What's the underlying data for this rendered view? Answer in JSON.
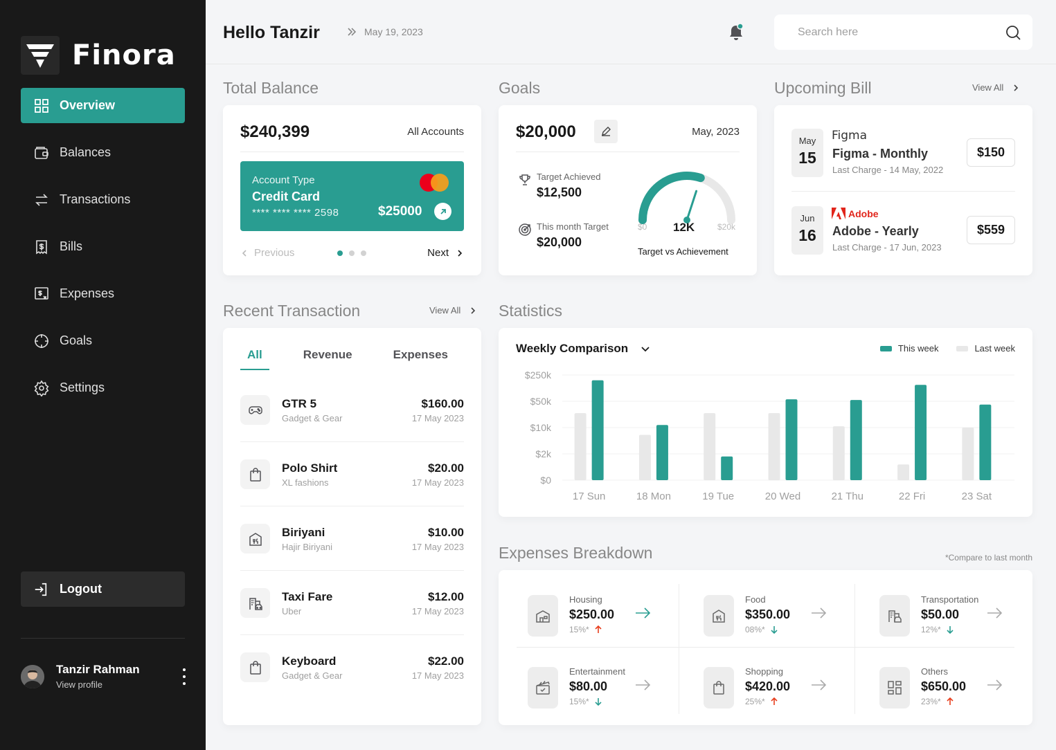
{
  "brand": {
    "name": "Finora"
  },
  "sidebar": {
    "items": [
      {
        "label": "Overview",
        "icon": "grid-icon",
        "active": true
      },
      {
        "label": "Balances",
        "icon": "wallet-icon",
        "active": false
      },
      {
        "label": "Transactions",
        "icon": "arrows-swap-icon",
        "active": false
      },
      {
        "label": "Bills",
        "icon": "bill-icon",
        "active": false
      },
      {
        "label": "Expenses",
        "icon": "expense-icon",
        "active": false
      },
      {
        "label": "Goals",
        "icon": "target-icon",
        "active": false
      },
      {
        "label": "Settings",
        "icon": "gear-icon",
        "active": false
      }
    ],
    "logout_label": "Logout",
    "profile": {
      "name": "Tanzir Rahman",
      "link": "View profile"
    }
  },
  "header": {
    "greeting": "Hello Tanzir",
    "date": "May 19, 2023",
    "search_placeholder": "Search here"
  },
  "total_balance": {
    "title": "Total Balance",
    "amount": "$240,399",
    "accounts_label": "All Accounts",
    "card": {
      "type_label": "Account Type",
      "type": "Credit Card",
      "number": "**** **** **** 2598",
      "balance": "$25000"
    },
    "prev_label": "Previous",
    "next_label": "Next"
  },
  "goals": {
    "title": "Goals",
    "amount": "$20,000",
    "date": "May, 2023",
    "achieved_label": "Target Achieved",
    "achieved_value": "$12,500",
    "month_label": "This month Target",
    "month_value": "$20,000",
    "gauge": {
      "min": "$0",
      "max": "$20k",
      "value_label": "12K",
      "value": 12000,
      "max_value": 20000
    },
    "caption": "Target vs Achievement"
  },
  "bills": {
    "title": "Upcoming Bill",
    "view_all": "View All",
    "items": [
      {
        "month": "May",
        "day": "15",
        "brand": "Figma",
        "name": "Figma - Monthly",
        "last": "Last Charge - 14 May, 2022",
        "amount": "$150"
      },
      {
        "month": "Jun",
        "day": "16",
        "brand": "Adobe",
        "name": "Adobe - Yearly",
        "last": "Last Charge - 17 Jun, 2023",
        "amount": "$559"
      }
    ]
  },
  "transactions": {
    "title": "Recent Transaction",
    "view_all": "View All",
    "tabs": [
      "All",
      "Revenue",
      "Expenses"
    ],
    "items": [
      {
        "name": "GTR 5",
        "category": "Gadget & Gear",
        "amount": "$160.00",
        "date": "17 May 2023",
        "icon": "gamepad-icon"
      },
      {
        "name": "Polo Shirt",
        "category": "XL fashions",
        "amount": "$20.00",
        "date": "17 May 2023",
        "icon": "shopping-bag-icon"
      },
      {
        "name": "Biriyani",
        "category": "Hajir Biriyani",
        "amount": "$10.00",
        "date": "17 May 2023",
        "icon": "restaurant-icon"
      },
      {
        "name": "Taxi Fare",
        "category": "Uber",
        "amount": "$12.00",
        "date": "17 May 2023",
        "icon": "taxi-building-icon"
      },
      {
        "name": "Keyboard",
        "category": "Gadget & Gear",
        "amount": "$22.00",
        "date": "17 May 2023",
        "icon": "shopping-bag-icon"
      }
    ]
  },
  "statistics": {
    "title": "Statistics",
    "subtitle": "Weekly Comparison",
    "legend": {
      "this_week": "This week",
      "last_week": "Last week"
    },
    "colors": {
      "this_week": "#299d91",
      "last_week": "#e8e8e8"
    }
  },
  "chart_data": {
    "type": "bar",
    "title": "Weekly Comparison",
    "categories": [
      "17 Sun",
      "18 Mon",
      "19 Tue",
      "20 Wed",
      "21 Thu",
      "22 Fri",
      "23 Sat"
    ],
    "y_ticks": [
      "$250k",
      "$50k",
      "$10k",
      "$2k",
      "$0"
    ],
    "y_tick_values": [
      250000,
      50000,
      10000,
      2000,
      0
    ],
    "series": [
      {
        "name": "Last week",
        "values": [
          32000,
          7800,
          32000,
          32000,
          12000,
          1200,
          10000
        ]
      },
      {
        "name": "This week",
        "values": [
          210000,
          14000,
          1800,
          65000,
          60000,
          175000,
          45000
        ]
      }
    ],
    "legend_position": "top-right",
    "grid": true
  },
  "expenses": {
    "title": "Expenses Breakdown",
    "note": "*Compare to last month",
    "items": [
      {
        "label": "Housing",
        "value": "$250.00",
        "pct": "15%*",
        "trend": "up",
        "icon": "house-icon"
      },
      {
        "label": "Food",
        "value": "$350.00",
        "pct": "08%*",
        "trend": "down",
        "icon": "restaurant-icon"
      },
      {
        "label": "Transportation",
        "value": "$50.00",
        "pct": "12%*",
        "trend": "down",
        "icon": "taxi-building-icon"
      },
      {
        "label": "Entertainment",
        "value": "$80.00",
        "pct": "15%*",
        "trend": "down",
        "icon": "clapper-icon"
      },
      {
        "label": "Shopping",
        "value": "$420.00",
        "pct": "25%*",
        "trend": "up",
        "icon": "shopping-bag-icon"
      },
      {
        "label": "Others",
        "value": "$650.00",
        "pct": "23%*",
        "trend": "up",
        "icon": "grid-icon"
      }
    ]
  }
}
